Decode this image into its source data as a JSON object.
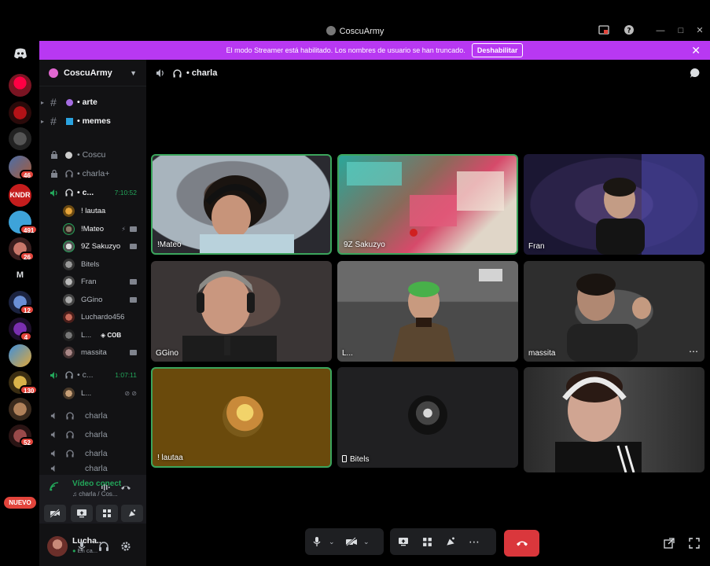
{
  "window": {
    "title": "CoscuArmy"
  },
  "banner": {
    "message": "El modo Streamer está habilitado. Los nombres de usuario se han truncado.",
    "button": "Deshabilitar"
  },
  "guilds": {
    "badges": [
      "46",
      "491",
      "26",
      "12",
      "4",
      "130",
      "52"
    ],
    "letter_m": "M",
    "new_label": "NUEVO"
  },
  "sidebar": {
    "server_name": "CoscuArmy",
    "text_channels": [
      {
        "name": "arte"
      },
      {
        "name": "memes"
      }
    ],
    "locked_channels": [
      {
        "name": "Coscu"
      },
      {
        "name": "charla+"
      }
    ],
    "active_voice": {
      "name": "c...",
      "timer": "7:10:52"
    },
    "voice_users": [
      {
        "name": "! lautaa"
      },
      {
        "name": "!Mateo"
      },
      {
        "name": "9Z Sakuzyo"
      },
      {
        "name": "Bitels"
      },
      {
        "name": "Fran"
      },
      {
        "name": "GGino"
      },
      {
        "name": "Luchardo456"
      },
      {
        "name": "L...",
        "tag": "COB"
      },
      {
        "name": "massita"
      }
    ],
    "second_voice": {
      "name": "c...",
      "timer": "1:07:11",
      "user": "L..."
    },
    "voice_channels": [
      "charla",
      "charla",
      "charla",
      "charla"
    ]
  },
  "voice_panel": {
    "status": "Vídeo conectado",
    "location": "charla / Cos..."
  },
  "user_panel": {
    "name": "Lucha...",
    "status": "En ca..."
  },
  "main": {
    "channel": "charla",
    "tiles": [
      {
        "name": "!Mateo"
      },
      {
        "name": "9Z Sakuzyo"
      },
      {
        "name": "Fran"
      },
      {
        "name": "GGino"
      },
      {
        "name": "L..."
      },
      {
        "name": "massita"
      },
      {
        "name": "! lautaa"
      },
      {
        "name": "Bitels"
      }
    ]
  },
  "colors": {
    "banner": "#b838f2",
    "speaking_border": "#3ba55c",
    "end_call": "#da373c",
    "voice_green": "#23a55a"
  }
}
